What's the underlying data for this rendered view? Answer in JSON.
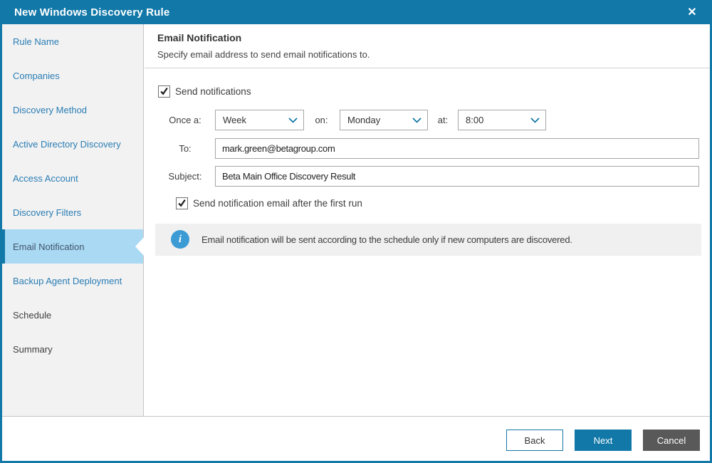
{
  "window": {
    "title": "New Windows Discovery Rule",
    "close_glyph": "✕"
  },
  "sidebar": {
    "items": [
      {
        "label": "Rule Name",
        "state": "enabled"
      },
      {
        "label": "Companies",
        "state": "enabled"
      },
      {
        "label": "Discovery Method",
        "state": "enabled"
      },
      {
        "label": "Active Directory Discovery",
        "state": "enabled"
      },
      {
        "label": "Access Account",
        "state": "enabled"
      },
      {
        "label": "Discovery Filters",
        "state": "enabled"
      },
      {
        "label": "Email Notification",
        "state": "active"
      },
      {
        "label": "Backup Agent Deployment",
        "state": "enabled"
      },
      {
        "label": "Schedule",
        "state": "disabled"
      },
      {
        "label": "Summary",
        "state": "disabled"
      }
    ]
  },
  "content": {
    "header": {
      "title": "Email Notification",
      "subtitle": "Specify email address to send email notifications to."
    },
    "form": {
      "send_notifications": {
        "label": "Send notifications",
        "checked": true
      },
      "schedule": {
        "once_a_label": "Once a:",
        "period_value": "Week",
        "on_label": "on:",
        "day_value": "Monday",
        "at_label": "at:",
        "time_value": "8:00"
      },
      "to": {
        "label": "To:",
        "value": "mark.green@betagroup.com"
      },
      "subject": {
        "label": "Subject:",
        "value": "Beta Main Office Discovery Result"
      },
      "first_run": {
        "label": "Send notification email after the first run",
        "checked": true
      },
      "info": {
        "glyph": "i",
        "text": "Email notification will be sent according to the schedule only if new computers are discovered."
      }
    }
  },
  "footer": {
    "back_label": "Back",
    "next_label": "Next",
    "cancel_label": "Cancel"
  },
  "colors": {
    "accent_blue": "#1178a8",
    "link_blue": "#2a7db4",
    "selected_item_bg": "#a9d9f3",
    "sidebar_bg": "#f2f2f2",
    "info_bar_bg": "#f0f0f0",
    "info_icon_blue": "#3c9bd5",
    "cancel_gray": "#595959"
  }
}
